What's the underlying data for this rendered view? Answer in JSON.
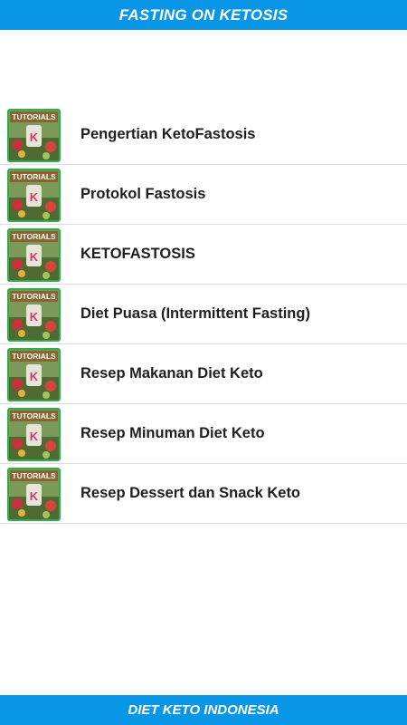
{
  "app": {
    "title": "FASTING ON KETOSIS",
    "footer": "DIET KETO INDONESIA"
  },
  "menu": {
    "thumbnail_icon": "keto-tutorials-thumbnail",
    "thumbnail_text": "TUTORIALS",
    "accent_color": "#0a96e6",
    "thumbnail_border_color": "#2fae4e",
    "items": [
      {
        "label": "Pengertian KetoFastosis"
      },
      {
        "label": "Protokol Fastosis"
      },
      {
        "label": "KETOFASTOSIS"
      },
      {
        "label": "Diet Puasa (Intermittent Fasting)"
      },
      {
        "label": "Resep Makanan Diet Keto"
      },
      {
        "label": "Resep Minuman Diet Keto"
      },
      {
        "label": "Resep Dessert dan Snack Keto"
      }
    ]
  }
}
